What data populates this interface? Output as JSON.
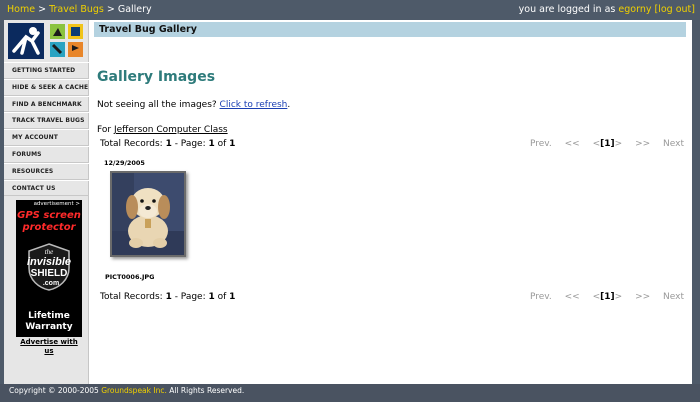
{
  "topbar": {
    "breadcrumbs": [
      "Home",
      "Travel Bugs",
      "Gallery"
    ],
    "separator": " > ",
    "login_text": "you are logged in as",
    "username": "egorny",
    "logout_label": "[log out]"
  },
  "sidebar": {
    "items": [
      {
        "label": "GETTING STARTED"
      },
      {
        "label": "HIDE & SEEK A CACHE"
      },
      {
        "label": "FIND A BENCHMARK"
      },
      {
        "label": "TRACK TRAVEL BUGS"
      },
      {
        "label": "MY ACCOUNT"
      },
      {
        "label": "FORUMS"
      },
      {
        "label": "RESOURCES"
      },
      {
        "label": "CONTACT US"
      }
    ],
    "ad": {
      "top_label": "advertisement >",
      "headline": "GPS screen protector",
      "logo_the": "the",
      "logo_word": "invisible",
      "logo_shield": "SHIELD",
      "logo_com": ".com",
      "warranty": "Lifetime Warranty",
      "advertise_label": "Advertise with us"
    }
  },
  "content": {
    "title": "Travel Bug Gallery",
    "heading": "Gallery Images",
    "notice_text": "Not seeing all the images? ",
    "refresh_link": "Click to refresh",
    "notice_end": ".",
    "for_label": "For ",
    "for_link": "Jefferson Computer Class",
    "records_top": {
      "label": "Total Records: ",
      "total": "1",
      "sep": " - Page: ",
      "page": "1",
      "of": " of ",
      "pages": "1"
    },
    "records_bottom": {
      "label": "Total Records: ",
      "total": "1",
      "sep": " - Page: ",
      "page": "1",
      "of": " of ",
      "pages": "1"
    },
    "pager": {
      "prev": "Prev.",
      "first": "<<",
      "lt": "<",
      "current": "[1]",
      "gt": ">",
      "last": ">>",
      "next": "Next"
    },
    "images": [
      {
        "date": "12/29/2005",
        "caption": "PICT0006.JPG"
      }
    ]
  },
  "footer": {
    "copyright": "Copyright © 2000-2005 ",
    "company": "Groundspeak Inc.",
    "rights": " All Rights Reserved."
  },
  "colors": {
    "frame_bg": "#4e5a69",
    "title_bar": "#b4d2e0",
    "heading": "#2e7b7b",
    "link_yellow": "#f0d000"
  }
}
